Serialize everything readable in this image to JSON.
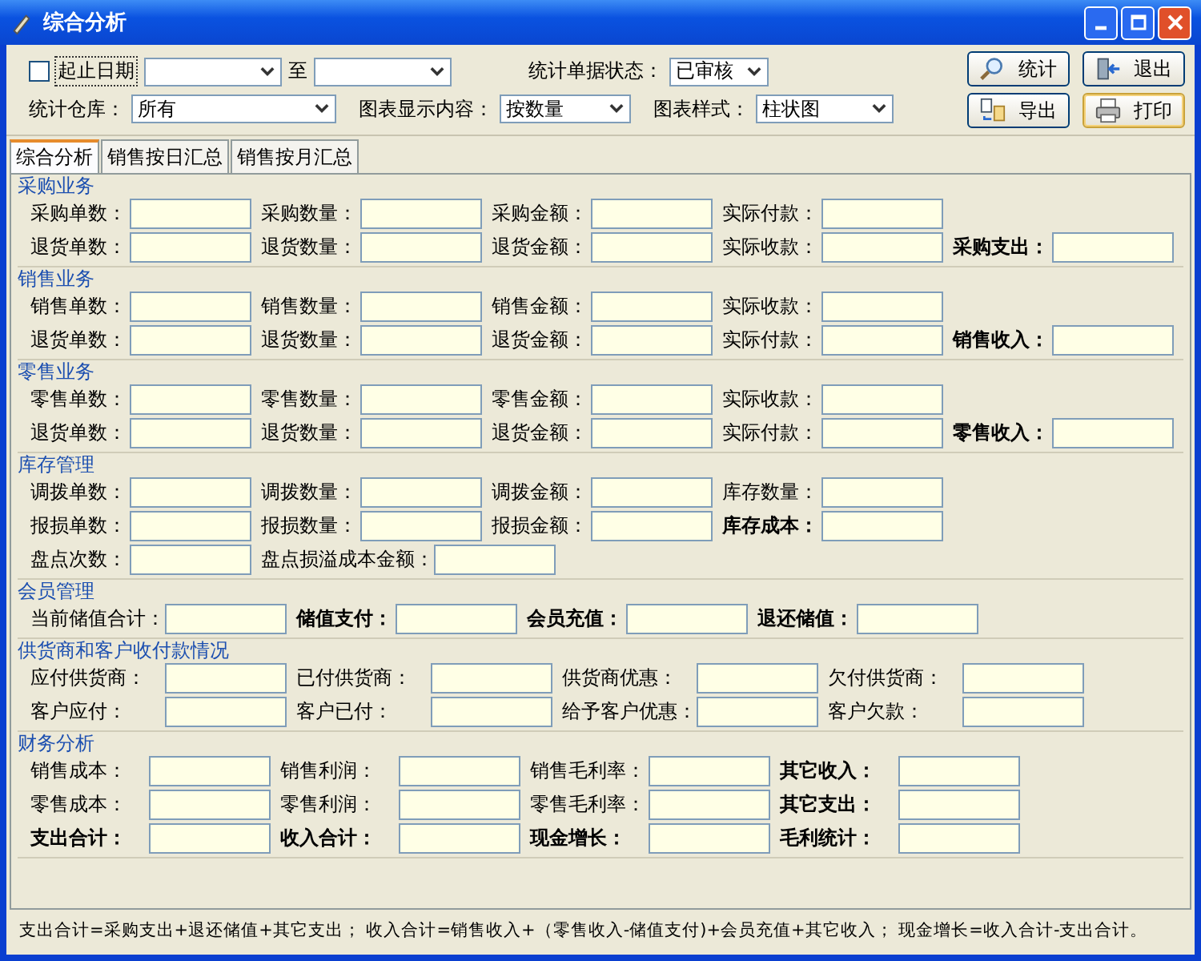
{
  "window": {
    "title": "综合分析"
  },
  "filters": {
    "date_range": {
      "label": "起止日期",
      "checked": false,
      "to_label": "至"
    },
    "doc_status": {
      "label": "统计单据状态：",
      "value": "已审核"
    },
    "warehouse": {
      "label": "统计仓库：",
      "value": "所有"
    },
    "chart_content": {
      "label": "图表显示内容：",
      "value": "按数量"
    },
    "chart_style": {
      "label": "图表样式：",
      "value": "柱状图"
    }
  },
  "buttons": [
    {
      "label": "统计",
      "kind": "search"
    },
    {
      "label": "退出",
      "kind": "exit"
    },
    {
      "label": "导出",
      "kind": "export"
    },
    {
      "label": "打印",
      "kind": "print"
    }
  ],
  "tabs": [
    {
      "label": "综合分析",
      "selected": true
    },
    {
      "label": "销售按日汇总",
      "selected": false
    },
    {
      "label": "销售按月汇总",
      "selected": false
    }
  ],
  "sections": [
    {
      "title": "采购业务",
      "rows": [
        [
          {
            "label": "采购单数：",
            "emphasis": false
          },
          {
            "label": "采购数量：",
            "emphasis": false
          },
          {
            "label": "采购金额：",
            "emphasis": false
          },
          {
            "label": "实际付款：",
            "emphasis": false
          }
        ],
        [
          {
            "label": "退货单数：",
            "emphasis": false
          },
          {
            "label": "退货数量：",
            "emphasis": false
          },
          {
            "label": "退货金额：",
            "emphasis": false
          },
          {
            "label": "实际收款：",
            "emphasis": false
          },
          {
            "label": "采购支出：",
            "emphasis": true
          }
        ]
      ]
    },
    {
      "title": "销售业务",
      "rows": [
        [
          {
            "label": "销售单数：",
            "emphasis": false
          },
          {
            "label": "销售数量：",
            "emphasis": false
          },
          {
            "label": "销售金额：",
            "emphasis": false
          },
          {
            "label": "实际收款：",
            "emphasis": false
          }
        ],
        [
          {
            "label": "退货单数：",
            "emphasis": false
          },
          {
            "label": "退货数量：",
            "emphasis": false
          },
          {
            "label": "退货金额：",
            "emphasis": false
          },
          {
            "label": "实际付款：",
            "emphasis": false
          },
          {
            "label": "销售收入：",
            "emphasis": true
          }
        ]
      ]
    },
    {
      "title": "零售业务",
      "rows": [
        [
          {
            "label": "零售单数：",
            "emphasis": false
          },
          {
            "label": "零售数量：",
            "emphasis": false
          },
          {
            "label": "零售金额：",
            "emphasis": false
          },
          {
            "label": "实际收款：",
            "emphasis": false
          }
        ],
        [
          {
            "label": "退货单数：",
            "emphasis": false
          },
          {
            "label": "退货数量：",
            "emphasis": false
          },
          {
            "label": "退货金额：",
            "emphasis": false
          },
          {
            "label": "实际付款：",
            "emphasis": false
          },
          {
            "label": "零售收入：",
            "emphasis": true
          }
        ]
      ]
    },
    {
      "title": "库存管理",
      "rows": [
        [
          {
            "label": "调拨单数：",
            "emphasis": false
          },
          {
            "label": "调拨数量：",
            "emphasis": false
          },
          {
            "label": "调拨金额：",
            "emphasis": false
          },
          {
            "label": "库存数量：",
            "emphasis": false
          }
        ],
        [
          {
            "label": "报损单数：",
            "emphasis": false
          },
          {
            "label": "报损数量：",
            "emphasis": false
          },
          {
            "label": "报损金额：",
            "emphasis": false
          },
          {
            "label": "库存成本：",
            "emphasis": true
          }
        ],
        [
          {
            "label": "盘点次数：",
            "emphasis": false
          },
          {
            "label": "盘点损溢成本金额：",
            "emphasis": false
          }
        ]
      ]
    },
    {
      "title": "会员管理",
      "rows": [
        [
          {
            "label": "当前储值合计：",
            "emphasis": false
          },
          {
            "label": "储值支付：",
            "emphasis": true
          },
          {
            "label": "会员充值：",
            "emphasis": true
          },
          {
            "label": "退还储值：",
            "emphasis": true
          }
        ]
      ]
    },
    {
      "title": "供货商和客户收付款情况",
      "rows": [
        [
          {
            "label": "应付供货商：",
            "emphasis": false
          },
          {
            "label": "已付供货商：",
            "emphasis": false
          },
          {
            "label": "供货商优惠：",
            "emphasis": false
          },
          {
            "label": "欠付供货商：",
            "emphasis": false
          }
        ],
        [
          {
            "label": "客户应付：",
            "emphasis": false
          },
          {
            "label": "客户已付：",
            "emphasis": false
          },
          {
            "label": "给予客户优惠：",
            "emphasis": false
          },
          {
            "label": "客户欠款：",
            "emphasis": false
          }
        ]
      ]
    },
    {
      "title": "财务分析",
      "rows": [
        [
          {
            "label": "销售成本：",
            "emphasis": false
          },
          {
            "label": "销售利润：",
            "emphasis": false
          },
          {
            "label": "销售毛利率：",
            "emphasis": false
          },
          {
            "label": "其它收入：",
            "emphasis": true
          }
        ],
        [
          {
            "label": "零售成本：",
            "emphasis": false
          },
          {
            "label": "零售利润：",
            "emphasis": false
          },
          {
            "label": "零售毛利率：",
            "emphasis": false
          },
          {
            "label": "其它支出：",
            "emphasis": true
          }
        ],
        [
          {
            "label": "支出合计：",
            "emphasis": true
          },
          {
            "label": "收入合计：",
            "emphasis": true
          },
          {
            "label": "现金增长：",
            "emphasis": true
          },
          {
            "label": "毛利统计：",
            "emphasis": true
          }
        ]
      ]
    }
  ],
  "footer": "支出合计=采购支出+退还储值+其它支出；  收入合计=销售收入+（零售收入-储值支付)+会员充值+其它收入；  现金增长=收入合计-支出合计。"
}
